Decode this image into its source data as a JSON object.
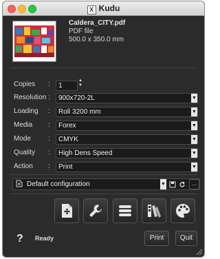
{
  "window": {
    "title": "Kudu"
  },
  "file": {
    "name": "Caldera_CITY.pdf",
    "type": "PDF file",
    "size": "500.0 x 350.0 mm"
  },
  "settings": [
    {
      "label": "Resolution",
      "value": "900x720-2L"
    },
    {
      "label": "Loading",
      "value": "Roll 3200 mm"
    },
    {
      "label": "Media",
      "value": "Forex"
    },
    {
      "label": "Mode",
      "value": "CMYK"
    },
    {
      "label": "Quality",
      "value": "High Dens Speed"
    },
    {
      "label": "Action",
      "value": "Print"
    }
  ],
  "copies": {
    "label": "Copies",
    "value": "1"
  },
  "colon": ":",
  "configuration": {
    "value": "Default configuration",
    "more": "..."
  },
  "toolbar": [
    {
      "icon": "add-page-icon"
    },
    {
      "icon": "wrench-icon"
    },
    {
      "icon": "list-icon"
    },
    {
      "icon": "swatch-book-icon"
    },
    {
      "icon": "palette-icon"
    }
  ],
  "footer": {
    "help": "?",
    "status": "Ready",
    "print_label": "Print",
    "quit_label": "Quit"
  },
  "colors": {
    "window_bg": "#2b2b2b",
    "field_bg": "#1b1b1b",
    "text": "#dcdcdc"
  }
}
